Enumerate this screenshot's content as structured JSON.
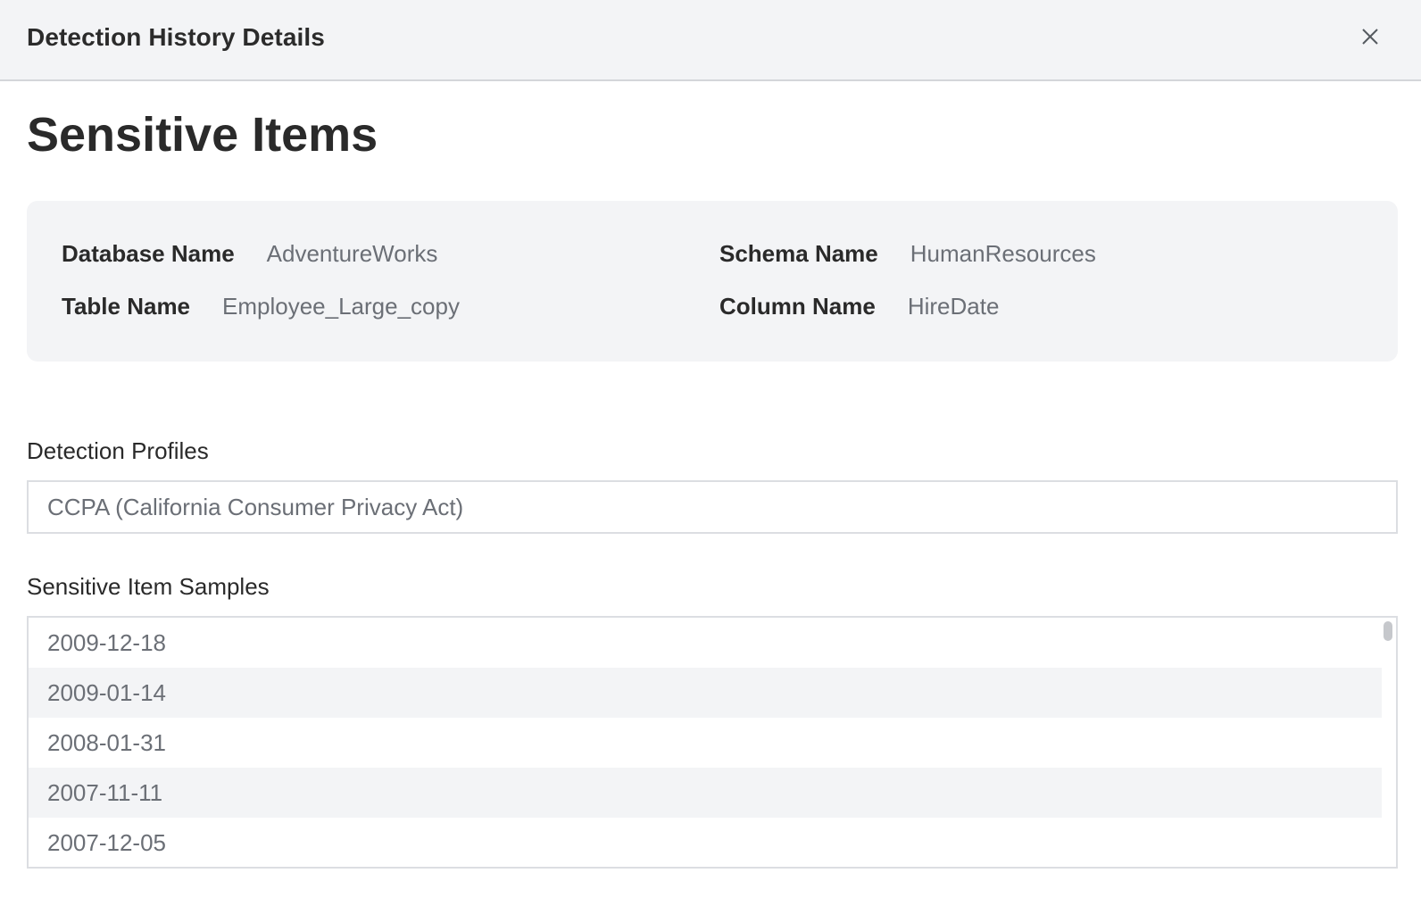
{
  "header": {
    "title": "Detection History Details",
    "close_icon": "close-icon"
  },
  "page_title": "Sensitive Items",
  "info": {
    "database_name_label": "Database Name",
    "database_name_value": "AdventureWorks",
    "schema_name_label": "Schema Name",
    "schema_name_value": "HumanResources",
    "table_name_label": "Table Name",
    "table_name_value": "Employee_Large_copy",
    "column_name_label": "Column Name",
    "column_name_value": "HireDate"
  },
  "detection_profiles": {
    "label": "Detection Profiles",
    "value": "CCPA (California Consumer Privacy Act)"
  },
  "samples": {
    "label": "Sensitive Item Samples",
    "items": [
      "2009-12-18",
      "2009-01-14",
      "2008-01-31",
      "2007-11-11",
      "2007-12-05"
    ]
  },
  "colors": {
    "header_bg": "#f3f4f6",
    "card_bg": "#f3f4f6",
    "value_text": "#6b6f76",
    "label_text": "#2a2a2a",
    "border": "#dcdee2"
  }
}
